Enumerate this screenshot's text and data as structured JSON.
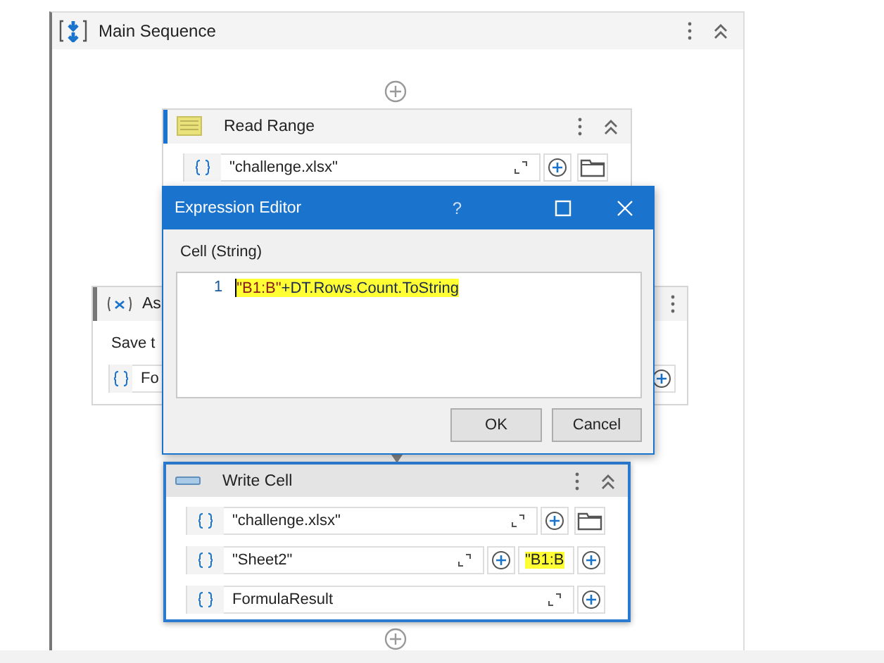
{
  "main_sequence": {
    "title": "Main Sequence"
  },
  "read_range": {
    "title": "Read Range",
    "rows": [
      {
        "browse": true,
        "fields": [
          {
            "value": "\"challenge.xlsx\"",
            "highlighted": false
          }
        ]
      }
    ]
  },
  "assign": {
    "title": "As",
    "label": "Save t",
    "field": "Fo"
  },
  "expression_editor": {
    "title": "Expression Editor",
    "help": "?",
    "label": "Cell (String)",
    "line_number": "1",
    "highlighted": true,
    "tokens": [
      {
        "kind": "string",
        "text": "\"B1:B\""
      },
      {
        "kind": "plain",
        "text": "+DT.Rows.Count.ToString"
      }
    ],
    "buttons": [
      "OK",
      "Cancel"
    ]
  },
  "write_cell": {
    "title": "Write Cell",
    "selected": true,
    "rows": [
      {
        "browse": true,
        "fields": [
          {
            "value": "\"challenge.xlsx\"",
            "highlighted": false
          }
        ]
      },
      {
        "browse": false,
        "fields": [
          {
            "value": "\"Sheet2\"",
            "highlighted": false
          },
          {
            "value": "\"B1:B",
            "highlighted": true
          }
        ]
      },
      {
        "browse": false,
        "fields": [
          {
            "value": "FormulaResult",
            "highlighted": false
          }
        ]
      }
    ]
  }
}
